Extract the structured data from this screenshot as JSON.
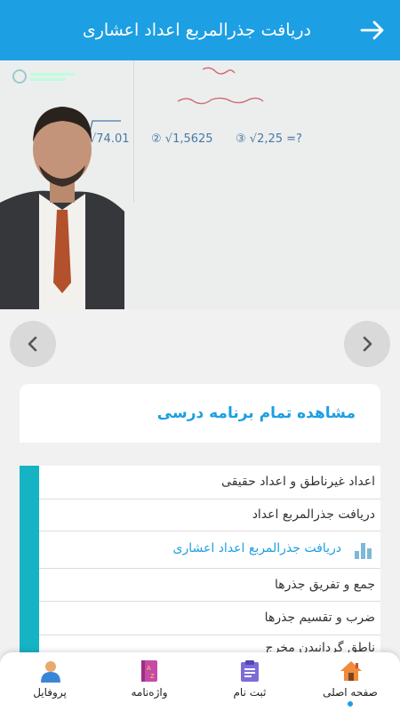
{
  "header": {
    "title": "دریافت جذرالمربع اعداد اعشاری"
  },
  "video": {
    "board_items": [
      "√74.01",
      "② √1,5625",
      "③ √2,25 =?"
    ]
  },
  "card": {
    "all_lessons": "مشاهده تمام برنامه درسی"
  },
  "lessons": [
    {
      "label": "اعداد غیرناطق و اعداد حقیقی"
    },
    {
      "label": "دریافت جذرالمربع اعداد"
    },
    {
      "label": "دریافت جذرالمربع اعداد اعشاری",
      "active": true
    },
    {
      "label": "جمع و تفریق جذرها"
    },
    {
      "label": "ضرب و تقسیم جذرها"
    },
    {
      "label": "ناطق گردانیدن مخرج"
    }
  ],
  "bottom_nav": [
    {
      "label": "صفحه اصلی",
      "icon": "home-icon",
      "active": true
    },
    {
      "label": "ثبت نام",
      "icon": "clipboard-icon"
    },
    {
      "label": "واژه‌نامه",
      "icon": "dictionary-icon"
    },
    {
      "label": "پروفایل",
      "icon": "profile-icon"
    }
  ],
  "colors": {
    "primary": "#1d9fe3",
    "accent_bar": "#16b3c4"
  }
}
